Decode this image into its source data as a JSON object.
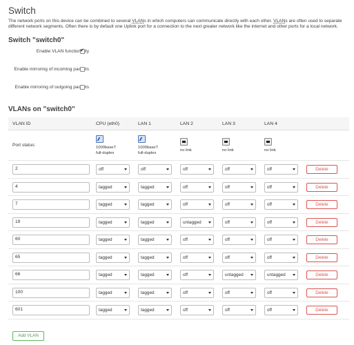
{
  "page": {
    "title": "Switch",
    "intro_parts": [
      "The network ports on this device can be combined to several ",
      "VLAN",
      "s in which computers can communicate directly with each other. ",
      "VLAN",
      "s are often used to separate different network segments. Often there is by default one Uplink port for a connection to the next greater network like the internet and other ports for a local network."
    ]
  },
  "switch": {
    "heading": "Switch \"switch0\"",
    "options": [
      {
        "label": "Enable VLAN functionality",
        "checked": true
      },
      {
        "label": "Enable mirroring of incoming packets",
        "checked": false
      },
      {
        "label": "Enable mirroring of outgoing packets",
        "checked": false
      }
    ]
  },
  "vlans": {
    "heading": "VLANs on \"switch0\"",
    "columns": [
      "VLAN ID",
      "CPU (eth0)",
      "LAN 1",
      "LAN 2",
      "LAN 3",
      "LAN 4",
      ""
    ],
    "port_status_label": "Port status:",
    "port_status": [
      {
        "icon": "ethernet-up-icon",
        "line1": "1000baseT",
        "line2": "full-duplex"
      },
      {
        "icon": "ethernet-up-icon",
        "line1": "1000baseT",
        "line2": "full-duplex"
      },
      {
        "icon": "ethernet-down-icon",
        "line1": "no link",
        "line2": ""
      },
      {
        "icon": "ethernet-down-icon",
        "line1": "no link",
        "line2": ""
      },
      {
        "icon": "ethernet-down-icon",
        "line1": "no link",
        "line2": ""
      }
    ],
    "rows": [
      {
        "id": "2",
        "ports": [
          "off",
          "off",
          "off",
          "off",
          "off"
        ]
      },
      {
        "id": "4",
        "ports": [
          "tagged",
          "tagged",
          "off",
          "off",
          "off"
        ]
      },
      {
        "id": "7",
        "ports": [
          "tagged",
          "tagged",
          "off",
          "off",
          "off"
        ]
      },
      {
        "id": "19",
        "ports": [
          "tagged",
          "tagged",
          "untagged",
          "off",
          "off"
        ]
      },
      {
        "id": "60",
        "ports": [
          "tagged",
          "tagged",
          "off",
          "off",
          "off"
        ]
      },
      {
        "id": "65",
        "ports": [
          "tagged",
          "tagged",
          "off",
          "off",
          "off"
        ]
      },
      {
        "id": "66",
        "ports": [
          "tagged",
          "tagged",
          "off",
          "untagged",
          "untagged"
        ]
      },
      {
        "id": "100",
        "ports": [
          "tagged",
          "tagged",
          "off",
          "off",
          "off"
        ]
      },
      {
        "id": "601",
        "ports": [
          "tagged",
          "tagged",
          "off",
          "off",
          "off"
        ]
      }
    ],
    "delete_label": "Delete",
    "add_label": "Add VLAN"
  },
  "colors": {
    "delete": "#d9534f",
    "add": "#5cb85c"
  }
}
